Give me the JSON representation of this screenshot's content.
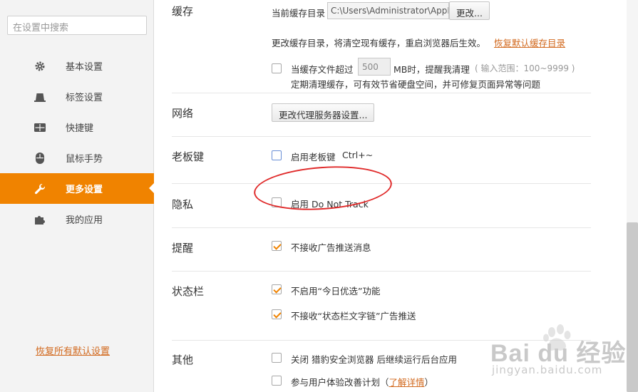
{
  "sidebar": {
    "search_placeholder": "在设置中搜索",
    "items": [
      {
        "label": "基本设置",
        "icon": "gear-icon"
      },
      {
        "label": "标签设置",
        "icon": "tab-icon"
      },
      {
        "label": "快捷键",
        "icon": "keyboard-icon"
      },
      {
        "label": "鼠标手势",
        "icon": "mouse-icon"
      },
      {
        "label": "更多设置",
        "icon": "wrench-icon",
        "active": true
      },
      {
        "label": "我的应用",
        "icon": "puzzle-icon"
      }
    ],
    "restore_defaults": "恢复所有默认设置"
  },
  "cache": {
    "title": "缓存",
    "current_dir_label": "当前缓存目录",
    "current_dir_value": "C:\\Users\\Administrator\\AppD",
    "change_button": "更改...",
    "note": "更改缓存目录，将清空现有缓存，重启浏览器后生效。",
    "restore_link": "恢复默认缓存目录",
    "limit_label_pre": "当缓存文件超过",
    "limit_value": "500",
    "limit_label_post": "MB时，提醒我清理",
    "limit_range": "( 输入范围：100~9999 )",
    "limit_desc": "定期清理缓存，可有效节省硬盘空间，并可修复页面异常等问题",
    "limit_checked": false
  },
  "network": {
    "title": "网络",
    "proxy_button": "更改代理服务器设置..."
  },
  "bosskey": {
    "title": "老板键",
    "enable_label": "启用老板键",
    "shortcut": "Ctrl+~",
    "checked": false
  },
  "privacy": {
    "title": "隐私",
    "dnt_label": "启用 Do Not Track",
    "checked": false
  },
  "reminder": {
    "title": "提醒",
    "no_ads_label": "不接收广告推送消息",
    "checked": true
  },
  "statusbar": {
    "title": "状态栏",
    "opt1": "不启用“今日优选”功能",
    "opt2": "不接收“状态栏文字链”广告推送",
    "opt1_checked": true,
    "opt2_checked": true
  },
  "other": {
    "title": "其他",
    "opt1": "关闭 猎豹安全浏览器 后继续运行后台应用",
    "opt2_pre": "参与用户体验改善计划（",
    "opt2_link": "了解详情",
    "opt2_post": "）",
    "opt1_checked": false,
    "opt2_checked": false
  },
  "watermark": {
    "brand": "Bai du 经验",
    "url": "jingyan.baidu.com"
  },
  "colors": {
    "accent": "#f08300",
    "link": "#d2691e",
    "annotation": "#e02a2a"
  }
}
